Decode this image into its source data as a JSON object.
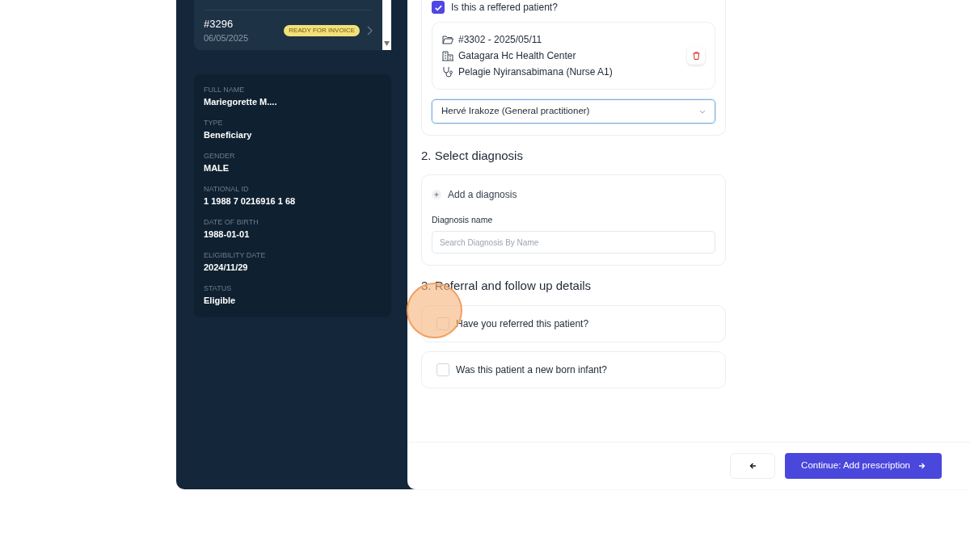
{
  "visit_list": [
    {
      "number": "#3296",
      "date": "06/05/2025",
      "badge": "READY FOR INVOICE"
    }
  ],
  "patient_info": [
    {
      "label": "FULL NAME",
      "value": "Mariegorette M...."
    },
    {
      "label": "TYPE",
      "value": "Beneficiary"
    },
    {
      "label": "GENDER",
      "value": "MALE"
    },
    {
      "label": "NATIONAL ID",
      "value": "1 1988 7 0216916 1 68"
    },
    {
      "label": "DATE OF BIRTH",
      "value": "1988-01-01"
    },
    {
      "label": "ELIGIBILITY DATE",
      "value": "2024/11/29"
    },
    {
      "label": "STATUS",
      "value": "Eligible"
    }
  ],
  "referred_question": {
    "label": "Is this a reffered patient?",
    "checked": true
  },
  "referral": {
    "visit": "#3302 - 2025/05/11",
    "facility": "Gatagara Hc Health Center",
    "practitioner": "Pelagie Nyiransabimana (Nurse A1)"
  },
  "doctor_select": {
    "value": "Hervé Irakoze (General practitioner)"
  },
  "diagnosis_section": {
    "title": "2. Select diagnosis",
    "add_label": "Add a diagnosis",
    "field_label": "Diagnosis name",
    "placeholder": "Search Diagnosis By Name"
  },
  "followup_section": {
    "title": "3. Referral and follow up details",
    "questions": [
      {
        "label": "Have you referred this patient?",
        "checked": false
      },
      {
        "label": "Was this patient a new born infant?",
        "checked": false
      }
    ]
  },
  "footer_buttons": {
    "continue": "Continue: Add prescription"
  }
}
